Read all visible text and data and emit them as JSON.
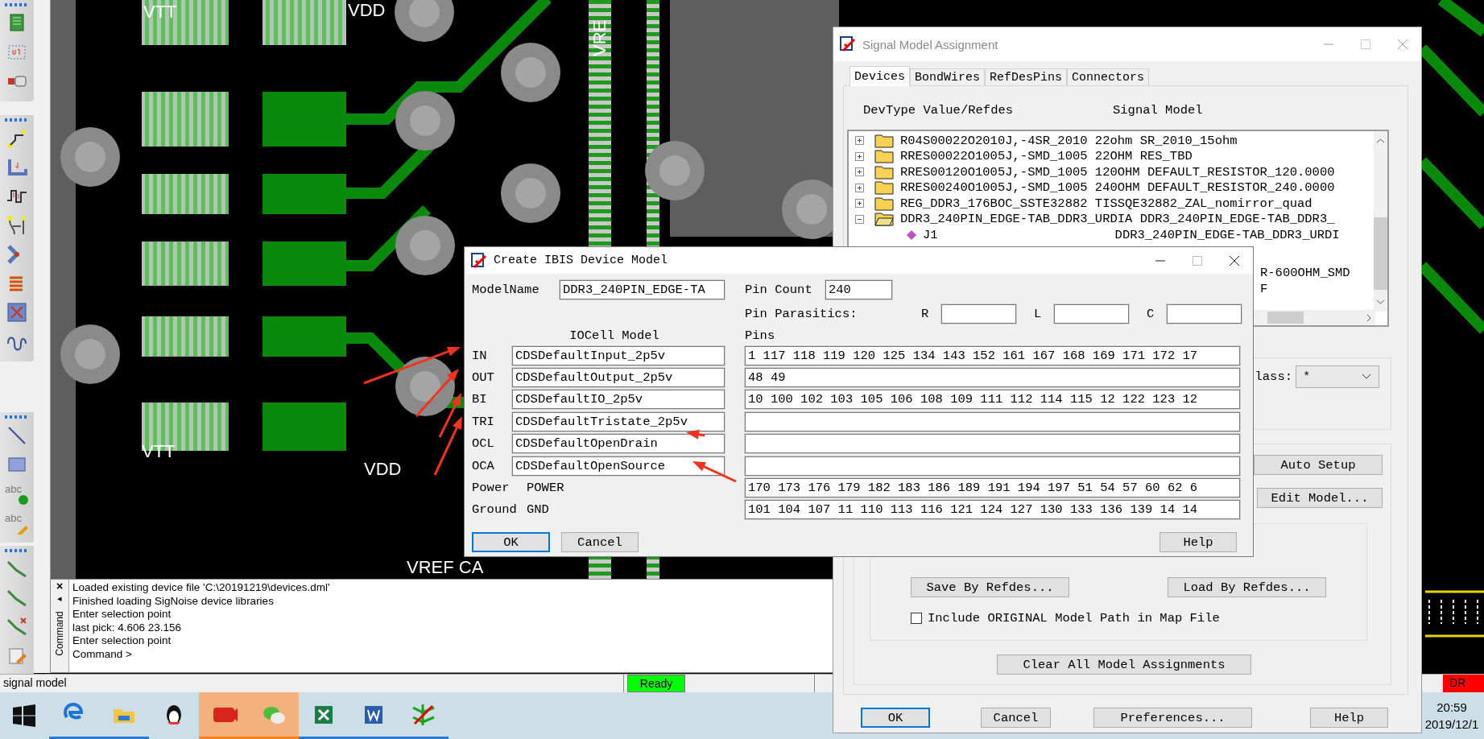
{
  "toolbar": {
    "groups": [
      {
        "items": [
          {
            "kind": "chip"
          },
          {
            "kind": "component"
          },
          {
            "kind": "connector"
          }
        ]
      },
      {
        "items": [
          {
            "kind": "route"
          },
          {
            "kind": "slide"
          },
          {
            "kind": "delay"
          },
          {
            "kind": "fanout"
          },
          {
            "kind": "merge"
          },
          {
            "kind": "bus"
          },
          {
            "kind": "grid"
          },
          {
            "kind": "loop"
          }
        ]
      },
      {
        "items": [
          {
            "kind": "line"
          },
          {
            "kind": "rect"
          },
          {
            "kind": "text-add",
            "label": "abc"
          },
          {
            "kind": "text-edit",
            "label": "abc"
          }
        ]
      },
      {
        "items": [
          {
            "kind": "trace"
          },
          {
            "kind": "trace"
          },
          {
            "kind": "trace-delete"
          },
          {
            "kind": "note"
          }
        ]
      }
    ]
  },
  "pcb": {
    "labels": [
      {
        "text": "VTT"
      },
      {
        "text": "VDD"
      },
      {
        "text": "VRE"
      },
      {
        "text": "VTT"
      },
      {
        "text": "VDD"
      },
      {
        "text": "VREF CA"
      }
    ]
  },
  "command_panel": {
    "close": "×",
    "pin": "◂",
    "title": "Command",
    "lines": [
      "Loaded existing device file 'C:\\20191219\\devices.dml'",
      "Finished loading SigNoise device libraries",
      "Enter selection point",
      "last pick:  4.606 23.156",
      "Enter selection point",
      "Command >"
    ]
  },
  "status_bar": {
    "message": "signal model",
    "state": "Ready",
    "drc": "DR"
  },
  "taskbar": {
    "apps": [
      {
        "kind": "edge",
        "running": true,
        "flashing": false
      },
      {
        "kind": "folder",
        "running": true,
        "flashing": false
      },
      {
        "kind": "penguin",
        "running": false,
        "flashing": false
      },
      {
        "kind": "live",
        "running": true,
        "flashing": true
      },
      {
        "kind": "chat",
        "running": true,
        "flashing": true
      },
      {
        "kind": "sheet",
        "running": true,
        "flashing": false
      },
      {
        "kind": "doc",
        "running": true,
        "flashing": false
      },
      {
        "kind": "pcb",
        "running": true,
        "flashing": false
      }
    ],
    "time": "20:59",
    "date": "2019/12/1"
  },
  "signal_dialog": {
    "title": "Signal Model Assignment",
    "tabs": [
      {
        "label": "Devices",
        "selected": true
      },
      {
        "label": "BondWires",
        "selected": false
      },
      {
        "label": "RefDesPins",
        "selected": false
      },
      {
        "label": "Connectors",
        "selected": false
      }
    ],
    "header": {
      "devtype": "DevType Value/Refdes",
      "model": "Signal Model"
    },
    "tree": [
      {
        "kind": "folder",
        "expanded": false,
        "text": "R04S00022O2010J,-4SR_2010 22ohm SR_2010_15ohm"
      },
      {
        "kind": "folder",
        "expanded": false,
        "text": "RRES00022O1005J,-SMD_1005 22OHM RES_TBD"
      },
      {
        "kind": "folder",
        "expanded": false,
        "text": "RRES00120O1005J,-SMD_1005 120OHM DEFAULT_RESISTOR_120.0000"
      },
      {
        "kind": "folder",
        "expanded": false,
        "text": "RRES00240O1005J,-SMD_1005 240OHM DEFAULT_RESISTOR_240.0000"
      },
      {
        "kind": "folder",
        "expanded": false,
        "text": "REG_DDR3_176BOC_SSTE32882 TISSQE32882_ZAL_nomirror_quad"
      },
      {
        "kind": "folder",
        "expanded": true,
        "text": "DDR3_240PIN_EDGE-TAB_DDR3_URDIA DDR3_240PIN_EDGE-TAB_DDR3_"
      },
      {
        "kind": "device",
        "text": "J1",
        "model": "DDR3_240PIN_EDGE-TAB_DDR3_URDI"
      },
      {
        "kind": "clipped",
        "text": "R-600OHM_SMD"
      },
      {
        "kind": "clipped",
        "text": "F"
      }
    ],
    "class_label": "lass:",
    "class_value": "*",
    "auto_setup": "Auto Setup",
    "edit_model": "Edit Model...",
    "save_refdes": "Save By Refdes...",
    "load_refdes": "Load By Refdes...",
    "include_original": {
      "label": "Include ORIGINAL Model Path in Map File",
      "checked": false
    },
    "clear_all": "Clear All Model Assignments",
    "buttons": [
      {
        "label": "OK",
        "default": true
      },
      {
        "label": "Cancel",
        "default": false
      },
      {
        "label": "Preferences...",
        "default": false
      },
      {
        "label": "Help",
        "default": false
      }
    ]
  },
  "ibis_dialog": {
    "title": "Create IBIS Device Model",
    "model_name_label": "ModelName",
    "model_name": "DDR3_240PIN_EDGE-TA",
    "pin_count_label": "Pin Count",
    "pin_count": "240",
    "parasitics_label": "Pin Parasitics:",
    "parasitics": [
      {
        "label": "R"
      },
      {
        "label": "L"
      },
      {
        "label": "C"
      }
    ],
    "iocell_header": "IOCell Model",
    "pins_header": "Pins",
    "rows": [
      {
        "kind": "field",
        "label": "IN",
        "model": "CDSDefaultInput_2p5v",
        "pins": "1 117 118 119 120 125 134 143 152 161 167 168 169 171 172 17"
      },
      {
        "kind": "field",
        "label": "OUT",
        "model": "CDSDefaultOutput_2p5v",
        "pins": "48 49"
      },
      {
        "kind": "field",
        "label": "BI",
        "model": "CDSDefaultIO_2p5v",
        "pins": "10 100 102 103 105 106 108 109 111 112 114 115 12 122 123 12"
      },
      {
        "kind": "field",
        "label": "TRI",
        "model": "CDSDefaultTristate_2p5v"
      },
      {
        "kind": "field",
        "label": "OCL",
        "model": "CDSDefaultOpenDrain"
      },
      {
        "kind": "field",
        "label": "OCA",
        "model": "CDSDefaultOpenSource"
      },
      {
        "kind": "fixed",
        "label": "Power",
        "model": "POWER",
        "pins": "170 173 176 179 182 183 186 189 191 194 197 51 54 57 60 62 6"
      },
      {
        "kind": "fixed",
        "label": "Ground",
        "model": "GND",
        "pins": "101 104 107 11 110 113 116 121 124 127 130 133 136 139 14 14"
      }
    ],
    "buttons": [
      {
        "label": "OK",
        "default": true
      },
      {
        "label": "Cancel",
        "default": false
      },
      {
        "label": "Help",
        "default": false
      }
    ]
  }
}
